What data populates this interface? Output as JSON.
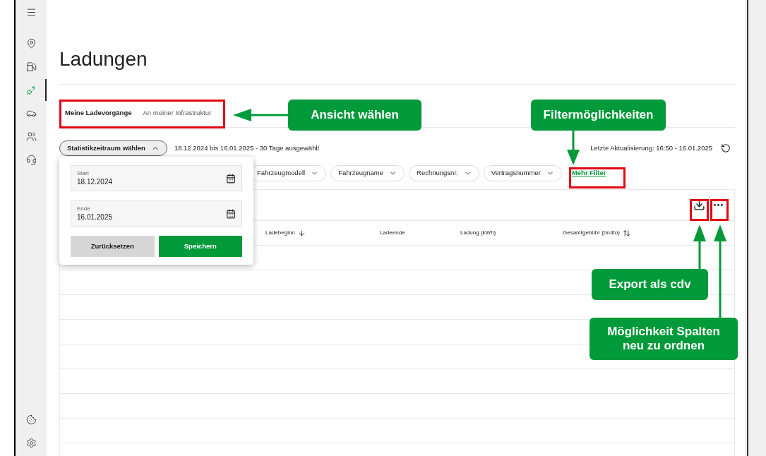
{
  "sidebar": {
    "items": [
      {
        "selected": false
      },
      {
        "selected": false
      },
      {
        "selected": false
      },
      {
        "selected": true
      },
      {
        "selected": false
      },
      {
        "selected": false
      },
      {
        "selected": false
      }
    ],
    "bottom_items": [
      {
        "selected": false
      },
      {
        "selected": false
      }
    ]
  },
  "page": {
    "title": "Ladungen"
  },
  "view_tabs": [
    {
      "label": "Meine Ladevorgänge",
      "selected": true
    },
    {
      "label": "An meiner Infrastruktur",
      "selected": false
    }
  ],
  "period": {
    "button": "Statistikzeitraum wählen",
    "expanded": true,
    "summary": "18.12.2024 bis 16.01.2025 - 30 Tage ausgewählt",
    "last_update": "Letzte Aktualisierung: 16:50 - 16.01.2025"
  },
  "filters": [
    {
      "label": "Fahrzeugmodell"
    },
    {
      "label": "Fahrzeugname"
    },
    {
      "label": "Rechnungsnr."
    },
    {
      "label": "Vertragsnummer"
    }
  ],
  "more_filters": "Mehr Filter",
  "date_popover": {
    "fields": [
      {
        "label": "Start",
        "value": "18.12.2024"
      },
      {
        "label": "Ende",
        "value": "16.01.2025"
      }
    ],
    "reset": "Zurücksetzen",
    "save": "Speichern"
  },
  "table": {
    "columns": [
      {
        "label": "Ladebeginn",
        "kind": "sorted"
      },
      {
        "label": "Ladeende",
        "kind": "plain"
      },
      {
        "label": "Ladung (kWh)",
        "kind": "plain"
      },
      {
        "label": "Gesamtgebühr (brutto)",
        "kind": "sortable"
      }
    ]
  },
  "annotations": [
    {
      "text": "Ansicht wählen"
    },
    {
      "text": "Filtermöglichkeiten"
    },
    {
      "text": "Export als cdv"
    },
    {
      "text": "Möglichkeit Spalten neu zu ordnen"
    }
  ]
}
